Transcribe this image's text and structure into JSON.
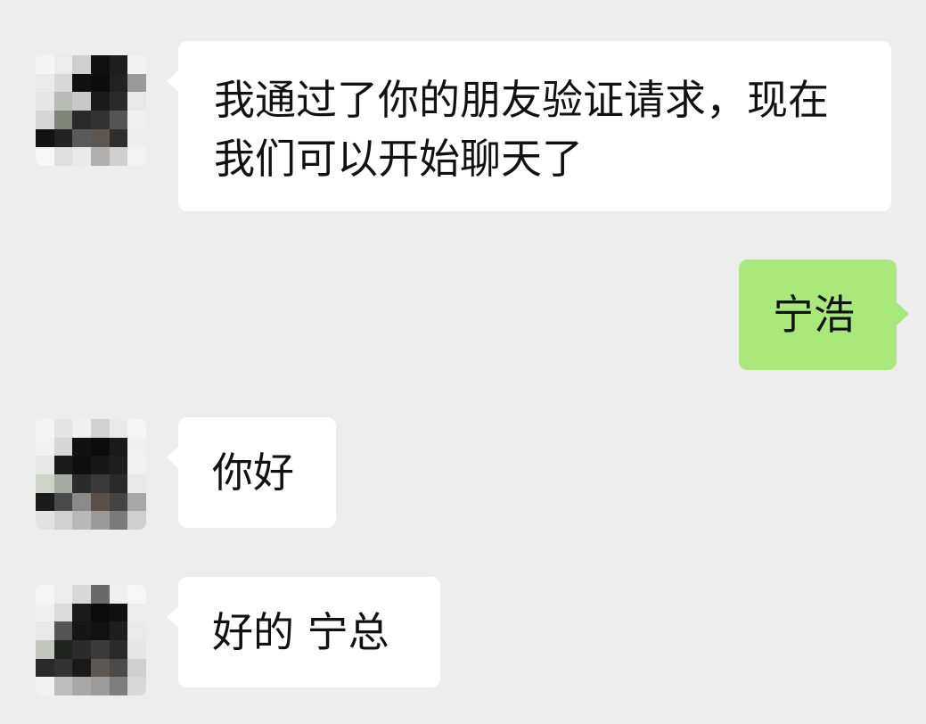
{
  "messages": [
    {
      "sender": "contact",
      "text": "我通过了你的朋友验证请求，现在我们可以开始聊天了"
    },
    {
      "sender": "me",
      "text": "宁浩"
    },
    {
      "sender": "contact",
      "text": "你好"
    },
    {
      "sender": "contact",
      "text": "好的 宁总"
    }
  ]
}
